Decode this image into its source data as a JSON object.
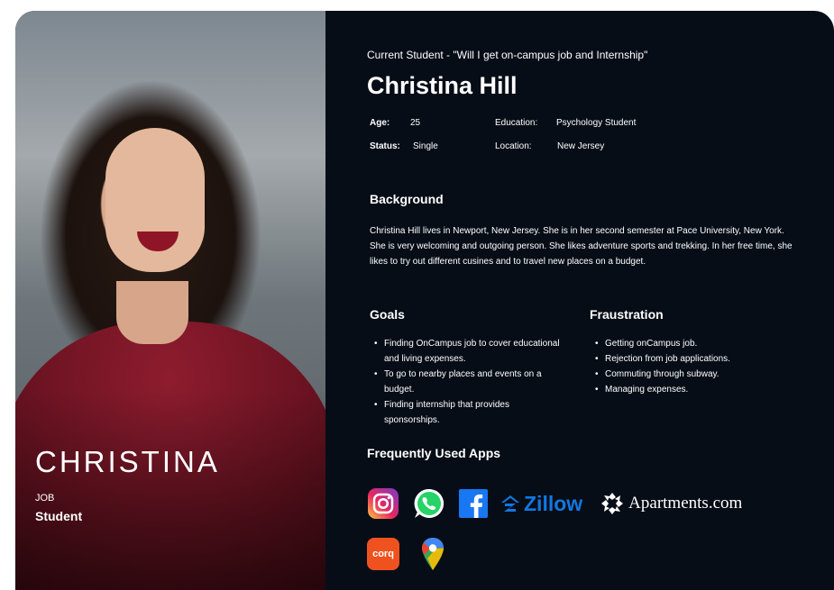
{
  "photo": {
    "name_overlay": "CHRISTINA",
    "job_label": "JOB",
    "job_value": "Student"
  },
  "persona": {
    "subtitle": "Current Student - \"Will I get on-campus job and Internship\"",
    "name": "Christina Hill",
    "age_label": "Age:",
    "age": "25",
    "education_label": "Education:",
    "education": "Psychology Student",
    "status_label": "Status:",
    "status": "Single",
    "location_label": "Location:",
    "location": "New Jersey"
  },
  "background": {
    "title": "Background",
    "text": "Christina Hill lives in Newport, New Jersey. She is in her second semester at Pace University, New York. She is very welcoming and outgoing person. She likes adventure sports and trekking. In her free time, she likes to try out different cusines and to travel new places on a budget."
  },
  "goals": {
    "title": "Goals",
    "items": [
      "Finding OnCampus job to cover educational and living expenses.",
      "To go to nearby places and events on a budget.",
      "Finding internship that provides sponsorships."
    ]
  },
  "frustration": {
    "title": "Fraustration",
    "items": [
      "Getting onCampus job.",
      "Rejection from job applications.",
      "Commuting through subway.",
      "Managing expenses."
    ]
  },
  "apps": {
    "title": "Frequently Used Apps",
    "zillow_label": "Zillow",
    "apartments_label": "Apartments.com",
    "corq_label": "corq",
    "icons": [
      "instagram-icon",
      "whatsapp-icon",
      "facebook-icon",
      "zillow-logo",
      "apartments-com-logo",
      "corq-icon",
      "google-maps-icon"
    ]
  },
  "colors": {
    "panel": "#070d17",
    "sweater": "#7a1526",
    "text": "#ffffff",
    "zillow_blue": "#1277e1",
    "corq_orange": "#f0521f",
    "facebook_blue": "#1877f2",
    "whatsapp_green": "#25d366"
  }
}
